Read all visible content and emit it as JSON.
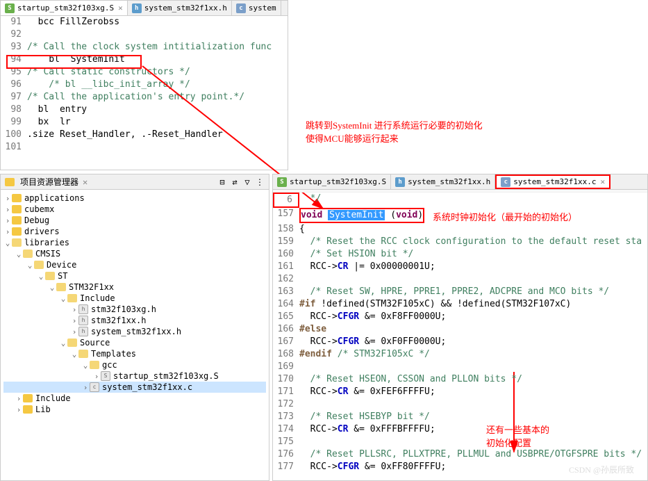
{
  "topTabs": [
    {
      "icon": "S",
      "iconClass": "icon-s",
      "label": "startup_stm32f103xg.S",
      "closable": true,
      "active": true
    },
    {
      "icon": "h",
      "iconClass": "icon-h",
      "label": "system_stm32f1xx.h",
      "closable": false,
      "active": false
    },
    {
      "icon": "c",
      "iconClass": "icon-c",
      "label": "system",
      "closable": false,
      "active": false
    }
  ],
  "topEditor": [
    {
      "n": "91",
      "code": "  bcc FillZerobss"
    },
    {
      "n": "92",
      "code": ""
    },
    {
      "n": "93",
      "code": "/* Call the clock system intitialization func",
      "cls": "comment"
    },
    {
      "n": "94",
      "code": "    bl  SystemInit"
    },
    {
      "n": "95",
      "code": "/* Call static constructors */",
      "cls": "comment"
    },
    {
      "n": "96",
      "code": "    /* bl __libc_init_array */",
      "cls": "comment"
    },
    {
      "n": "97",
      "code": "/* Call the application's entry point.*/",
      "cls": "comment"
    },
    {
      "n": "98",
      "code": "  bl  entry"
    },
    {
      "n": "99",
      "code": "  bx  lr"
    },
    {
      "n": "100",
      "code": ".size Reset_Handler, .-Reset_Handler"
    },
    {
      "n": "101",
      "code": ""
    }
  ],
  "annotations": {
    "a1line1": "跳转到SystemInit 进行系统运行必要的初始化",
    "a1line2": "使得MCU能够运行起来",
    "a2": "系统时钟初始化（最开始的初始化）",
    "a3line1": "还有一些基本的",
    "a3line2": "初始化配置"
  },
  "explorer": {
    "title": "项目资源管理器",
    "tree": [
      {
        "depth": 0,
        "exp": ">",
        "type": "folder",
        "label": "applications"
      },
      {
        "depth": 0,
        "exp": ">",
        "type": "folder",
        "label": "cubemx"
      },
      {
        "depth": 0,
        "exp": ">",
        "type": "folder",
        "label": "Debug"
      },
      {
        "depth": 0,
        "exp": ">",
        "type": "folder",
        "label": "drivers"
      },
      {
        "depth": 0,
        "exp": "v",
        "type": "folder",
        "label": "libraries",
        "open": true
      },
      {
        "depth": 1,
        "exp": "v",
        "type": "folder",
        "label": "CMSIS",
        "open": true
      },
      {
        "depth": 2,
        "exp": "v",
        "type": "folder",
        "label": "Device",
        "open": true
      },
      {
        "depth": 3,
        "exp": "v",
        "type": "folder",
        "label": "ST",
        "open": true
      },
      {
        "depth": 4,
        "exp": "v",
        "type": "folder",
        "label": "STM32F1xx",
        "open": true
      },
      {
        "depth": 5,
        "exp": "v",
        "type": "folder",
        "label": "Include",
        "open": true
      },
      {
        "depth": 6,
        "exp": ">",
        "type": "file-h",
        "label": "stm32f103xg.h"
      },
      {
        "depth": 6,
        "exp": ">",
        "type": "file-h",
        "label": "stm32f1xx.h"
      },
      {
        "depth": 6,
        "exp": ">",
        "type": "file-h",
        "label": "system_stm32f1xx.h"
      },
      {
        "depth": 5,
        "exp": "v",
        "type": "folder",
        "label": "Source",
        "open": true
      },
      {
        "depth": 6,
        "exp": "v",
        "type": "folder",
        "label": "Templates",
        "open": true
      },
      {
        "depth": 7,
        "exp": "v",
        "type": "folder",
        "label": "gcc",
        "open": true
      },
      {
        "depth": 8,
        "exp": ">",
        "type": "file-s",
        "label": "startup_stm32f103xg.S"
      },
      {
        "depth": 7,
        "exp": ">",
        "type": "file-c",
        "label": "system_stm32f1xx.c",
        "selected": true
      },
      {
        "depth": 1,
        "exp": ">",
        "type": "folder",
        "label": "Include"
      },
      {
        "depth": 1,
        "exp": ">",
        "type": "folder",
        "label": "Lib"
      }
    ]
  },
  "bottomTabs": [
    {
      "icon": "S",
      "iconClass": "icon-s",
      "label": "startup_stm32f103xg.S",
      "active": false
    },
    {
      "icon": "h",
      "iconClass": "icon-h",
      "label": "system_stm32f1xx.h",
      "active": false
    },
    {
      "icon": "c",
      "iconClass": "icon-c",
      "label": "system_stm32f1xx.c",
      "active": true,
      "hl": true,
      "closable": true
    }
  ],
  "bottomEditor": {
    "lines": [
      {
        "n": "6",
        "html": "  */",
        "cls": "comment",
        "hln": true
      },
      {
        "n": "157",
        "html": "<span class='void-kw'>void</span> <span class='sel-blue'>SystemInit</span> (<span class='void-kw'>void</span>)",
        "hlline": true
      },
      {
        "n": "158",
        "html": "{"
      },
      {
        "n": "159",
        "html": "  /* Reset the RCC clock configuration to the default reset sta",
        "cls": "comment"
      },
      {
        "n": "160",
        "html": "  /* Set HSION bit */",
        "cls": "comment"
      },
      {
        "n": "161",
        "html": "  RCC-><span class='kw-blue'>CR</span> |= 0x00000001U;"
      },
      {
        "n": "162",
        "html": ""
      },
      {
        "n": "163",
        "html": "  /* Reset SW, HPRE, PPRE1, PPRE2, ADCPRE and MCO bits */",
        "cls": "comment"
      },
      {
        "n": "164",
        "html": "<span class='preproc'>#if</span> !defined(STM32F105xC) && !defined(STM32F107xC)"
      },
      {
        "n": "165",
        "html": "  RCC-><span class='kw-blue'>CFGR</span> &= 0xF8FF0000U;"
      },
      {
        "n": "166",
        "html": "<span class='preproc'>#else</span>"
      },
      {
        "n": "167",
        "html": "  RCC-><span class='kw-blue'>CFGR</span> &= 0xF0FF0000U;"
      },
      {
        "n": "168",
        "html": "<span class='preproc'>#endif</span> <span class='comment'>/* STM32F105xC */</span>"
      },
      {
        "n": "169",
        "html": ""
      },
      {
        "n": "170",
        "html": "  /* Reset HSEON, CSSON and PLLON bits */",
        "cls": "comment"
      },
      {
        "n": "171",
        "html": "  RCC-><span class='kw-blue'>CR</span> &= 0xFEF6FFFFU;"
      },
      {
        "n": "172",
        "html": ""
      },
      {
        "n": "173",
        "html": "  /* Reset HSEBYP bit */",
        "cls": "comment"
      },
      {
        "n": "174",
        "html": "  RCC-><span class='kw-blue'>CR</span> &= 0xFFFBFFFFU;"
      },
      {
        "n": "175",
        "html": ""
      },
      {
        "n": "176",
        "html": "  /* Reset PLLSRC, PLLXTPRE, PLLMUL and USBPRE/OTGFSPRE bits */",
        "cls": "comment"
      },
      {
        "n": "177",
        "html": "  RCC-><span class='kw-blue'>CFGR</span> &= 0xFF80FFFFU;"
      }
    ]
  },
  "watermark": "CSDN @孙辰所致"
}
